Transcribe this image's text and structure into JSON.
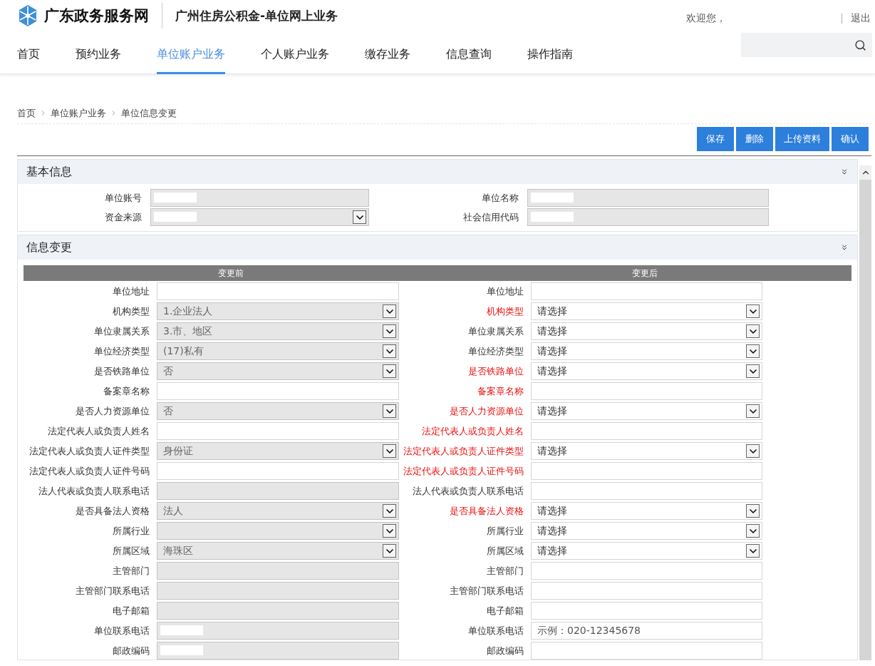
{
  "header": {
    "site_name": "广东政务服务网",
    "subtitle": "广州住房公积金-单位网上业务",
    "welcome": "欢迎您，",
    "logout": "退出"
  },
  "nav": [
    {
      "label": "首页",
      "selected": false
    },
    {
      "label": "预约业务",
      "selected": false
    },
    {
      "label": "单位账户业务",
      "selected": true
    },
    {
      "label": "个人账户业务",
      "selected": false
    },
    {
      "label": "缴存业务",
      "selected": false
    },
    {
      "label": "信息查询",
      "selected": false
    },
    {
      "label": "操作指南",
      "selected": false
    }
  ],
  "breadcrumb": [
    "首页",
    "单位账户业务",
    "单位信息变更"
  ],
  "actions": [
    "保存",
    "删除",
    "上传资料",
    "确认"
  ],
  "basic_info": {
    "title": "基本信息",
    "fields": [
      {
        "label": "单位账号",
        "kind": "input",
        "disabled": true,
        "redacted": true
      },
      {
        "label": "单位名称",
        "kind": "input",
        "disabled": true,
        "redacted": true
      },
      {
        "label": "资金来源",
        "kind": "select",
        "disabled": true,
        "redacted": true
      },
      {
        "label": "社会信用代码",
        "kind": "input",
        "disabled": true,
        "redacted": true
      }
    ]
  },
  "change": {
    "title": "信息变更",
    "before_heading": "变更前",
    "after_heading": "变更后",
    "rows": [
      {
        "before": {
          "label": "单位地址",
          "kind": "input",
          "disabled": false
        },
        "after": {
          "label": "单位地址",
          "required": false,
          "kind": "input"
        }
      },
      {
        "before": {
          "label": "机构类型",
          "kind": "select",
          "value": "1.企业法人",
          "disabled": true
        },
        "after": {
          "label": "机构类型",
          "required": true,
          "kind": "select",
          "value": "请选择"
        }
      },
      {
        "before": {
          "label": "单位隶属关系",
          "kind": "select",
          "value": "3.市、地区",
          "disabled": true
        },
        "after": {
          "label": "单位隶属关系",
          "required": false,
          "kind": "select",
          "value": "请选择"
        }
      },
      {
        "before": {
          "label": "单位经济类型",
          "kind": "select",
          "value": "(17)私有",
          "disabled": true
        },
        "after": {
          "label": "单位经济类型",
          "required": false,
          "kind": "select",
          "value": "请选择"
        }
      },
      {
        "before": {
          "label": "是否铁路单位",
          "kind": "select",
          "value": "否",
          "disabled": true
        },
        "after": {
          "label": "是否铁路单位",
          "required": true,
          "kind": "select",
          "value": "请选择"
        }
      },
      {
        "before": {
          "label": "备案章名称",
          "kind": "input",
          "disabled": false
        },
        "after": {
          "label": "备案章名称",
          "required": true,
          "kind": "input"
        }
      },
      {
        "before": {
          "label": "是否人力资源单位",
          "kind": "select",
          "value": "否",
          "disabled": true
        },
        "after": {
          "label": "是否人力资源单位",
          "required": true,
          "kind": "select",
          "value": "请选择"
        }
      },
      {
        "before": {
          "label": "法定代表人或负责人姓名",
          "kind": "input",
          "disabled": false
        },
        "after": {
          "label": "法定代表人或负责人姓名",
          "required": true,
          "kind": "input"
        }
      },
      {
        "before": {
          "label": "法定代表人或负责人证件类型",
          "kind": "select",
          "value": "身份证",
          "disabled": true
        },
        "after": {
          "label": "法定代表人或负责人证件类型",
          "required": true,
          "kind": "select",
          "value": "请选择"
        }
      },
      {
        "before": {
          "label": "法定代表人或负责人证件号码",
          "kind": "input",
          "disabled": false
        },
        "after": {
          "label": "法定代表人或负责人证件号码",
          "required": true,
          "kind": "input"
        }
      },
      {
        "before": {
          "label": "法人代表或负责人联系电话",
          "kind": "input",
          "disabled": true
        },
        "after": {
          "label": "法人代表或负责人联系电话",
          "required": false,
          "kind": "input"
        }
      },
      {
        "before": {
          "label": "是否具备法人资格",
          "kind": "select",
          "value": "法人",
          "disabled": true
        },
        "after": {
          "label": "是否具备法人资格",
          "required": true,
          "kind": "select",
          "value": "请选择"
        }
      },
      {
        "before": {
          "label": "所属行业",
          "kind": "select",
          "disabled": true
        },
        "after": {
          "label": "所属行业",
          "required": false,
          "kind": "select",
          "value": "请选择"
        }
      },
      {
        "before": {
          "label": "所属区域",
          "kind": "select",
          "value": "海珠区",
          "disabled": true
        },
        "after": {
          "label": "所属区域",
          "required": false,
          "kind": "select",
          "value": "请选择"
        }
      },
      {
        "before": {
          "label": "主管部门",
          "kind": "input",
          "disabled": true
        },
        "after": {
          "label": "主管部门",
          "required": false,
          "kind": "input"
        }
      },
      {
        "before": {
          "label": "主管部门联系电话",
          "kind": "input",
          "disabled": true
        },
        "after": {
          "label": "主管部门联系电话",
          "required": false,
          "kind": "input"
        }
      },
      {
        "before": {
          "label": "电子邮箱",
          "kind": "input",
          "disabled": true
        },
        "after": {
          "label": "电子邮箱",
          "required": false,
          "kind": "input"
        }
      },
      {
        "before": {
          "label": "单位联系电话",
          "kind": "input",
          "disabled": true,
          "redacted": true
        },
        "after": {
          "label": "单位联系电话",
          "required": false,
          "kind": "input",
          "placeholder": "示例：020-12345678"
        }
      },
      {
        "before": {
          "label": "邮政编码",
          "kind": "input",
          "disabled": true,
          "redacted": true
        },
        "after": {
          "label": "邮政编码",
          "required": false,
          "kind": "input"
        }
      }
    ]
  }
}
